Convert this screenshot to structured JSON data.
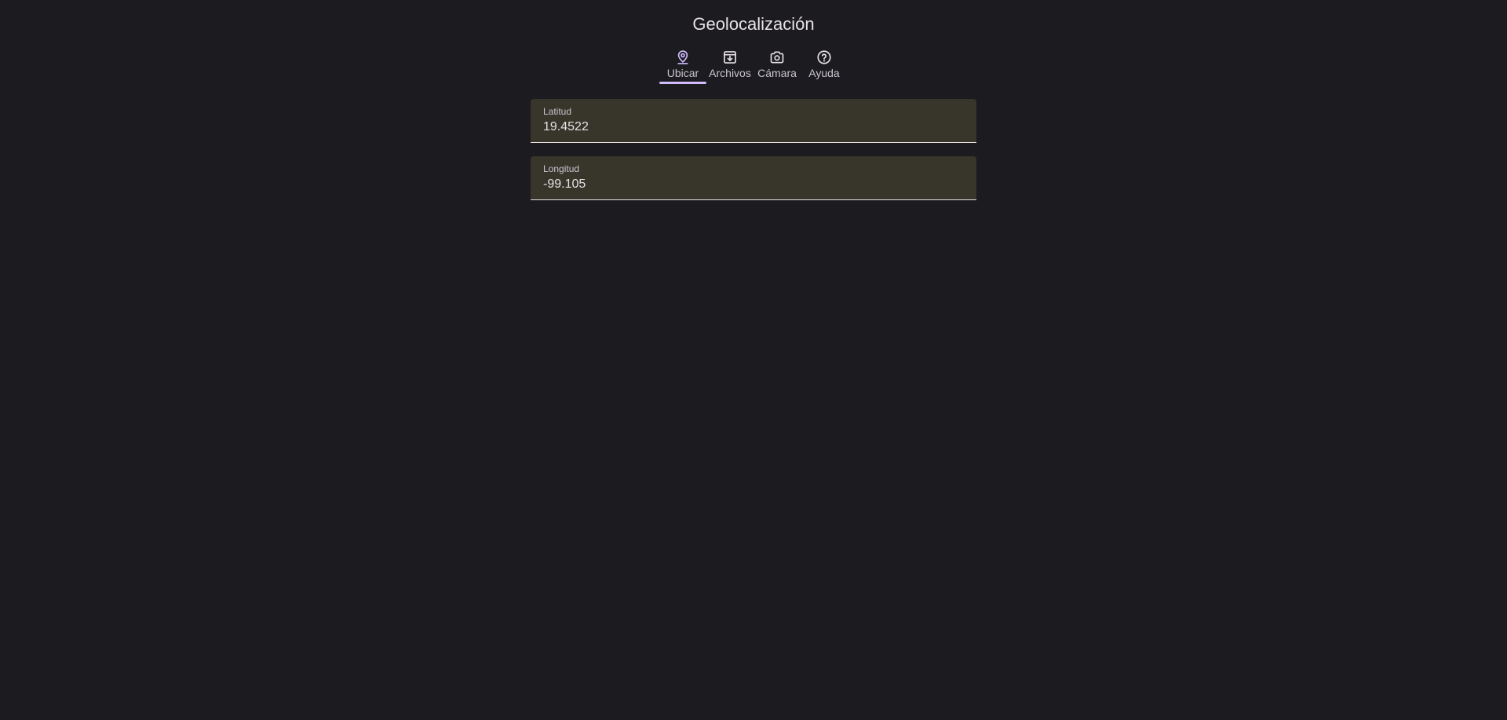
{
  "header": {
    "title": "Geolocalización"
  },
  "tabs": [
    {
      "label": "Ubicar",
      "icon": "location-pin-icon",
      "active": true
    },
    {
      "label": "Archivos",
      "icon": "archive-download-icon",
      "active": false
    },
    {
      "label": "Cámara",
      "icon": "camera-icon",
      "active": false
    },
    {
      "label": "Ayuda",
      "icon": "help-circle-icon",
      "active": false
    }
  ],
  "fields": {
    "latitude": {
      "label": "Latitud",
      "value": "19.4522"
    },
    "longitude": {
      "label": "Longitud",
      "value": "-99.105"
    }
  },
  "colors": {
    "background": "#1c1b1f",
    "accent": "#d0bcff",
    "field_background": "#38352b",
    "text": "#e6e1e5"
  }
}
